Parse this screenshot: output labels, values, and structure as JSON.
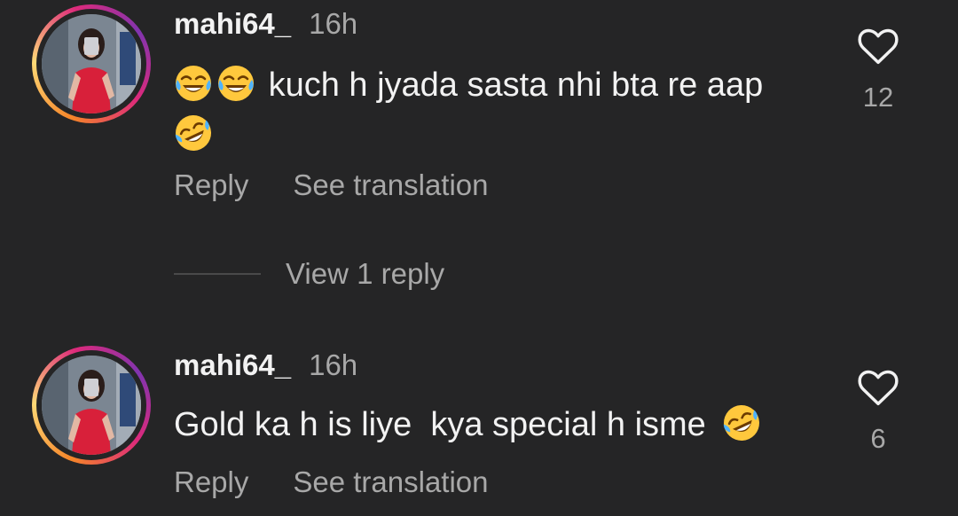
{
  "comments": [
    {
      "username": "mahi64_",
      "time": "16h",
      "text": "kuch h jyada sasta nhi bta re aap",
      "text_emoji_icons": [
        "joy-emoji-icon",
        "joy-emoji-icon"
      ],
      "trailing_emoji_icon": "rofl-emoji-icon",
      "likes": "12",
      "reply_label": "Reply",
      "translate_label": "See translation"
    },
    {
      "username": "mahi64_",
      "time": "16h",
      "text": "Gold ka h is liye  kya special h isme",
      "trailing_emoji_icon": "rofl-emoji-icon",
      "likes": "6",
      "reply_label": "Reply",
      "translate_label": "See translation"
    }
  ],
  "view_replies_label": "View 1 reply",
  "colors": {
    "background": "#252526",
    "primary_text": "#f2f2f2",
    "secondary_text": "#a8a8a8",
    "story_ring": [
      "#f58529",
      "#feda77",
      "#dd2a7b",
      "#8134af"
    ]
  }
}
